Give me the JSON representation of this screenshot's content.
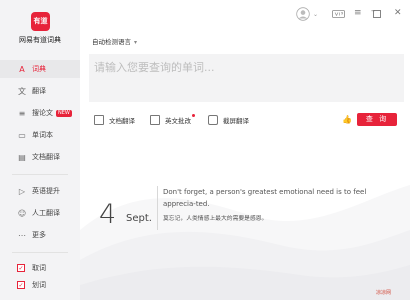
{
  "app": {
    "logo_text": "有道",
    "name": "网易有道词典"
  },
  "sidebar": {
    "items": [
      {
        "label": "词典",
        "icon": "A"
      },
      {
        "label": "翻译",
        "icon": "文"
      },
      {
        "label": "搜论文",
        "icon": "≡",
        "badge": "NEW"
      },
      {
        "label": "单词本",
        "icon": "▭"
      },
      {
        "label": "文档翻译",
        "icon": "▤"
      },
      {
        "label": "英语提升",
        "icon": "▷"
      },
      {
        "label": "人工翻译",
        "icon": "☺"
      },
      {
        "label": "更多",
        "icon": "⋯"
      }
    ],
    "toggles": [
      {
        "label": "取词",
        "checked": true
      },
      {
        "label": "划词",
        "checked": true
      }
    ]
  },
  "header": {
    "language": "自动检测语言"
  },
  "search": {
    "placeholder": "请输入您要查询的单词..."
  },
  "toolbar": {
    "doc_translate": "文档翻译",
    "essay_check": "英文批改",
    "screenshot_translate": "截屏翻译",
    "query_button": "查 询"
  },
  "daily": {
    "day": "4",
    "month": "Sept.",
    "quote_en": "Don't forget, a person's greatest emotional need is to feel apprecia-ted.",
    "quote_cn": "莫忘记，人类情感上最大的需要是感恩。"
  },
  "watermark": "凉凉网",
  "colors": {
    "accent": "#e7233a",
    "sidebar_bg": "#f3f3f5"
  }
}
